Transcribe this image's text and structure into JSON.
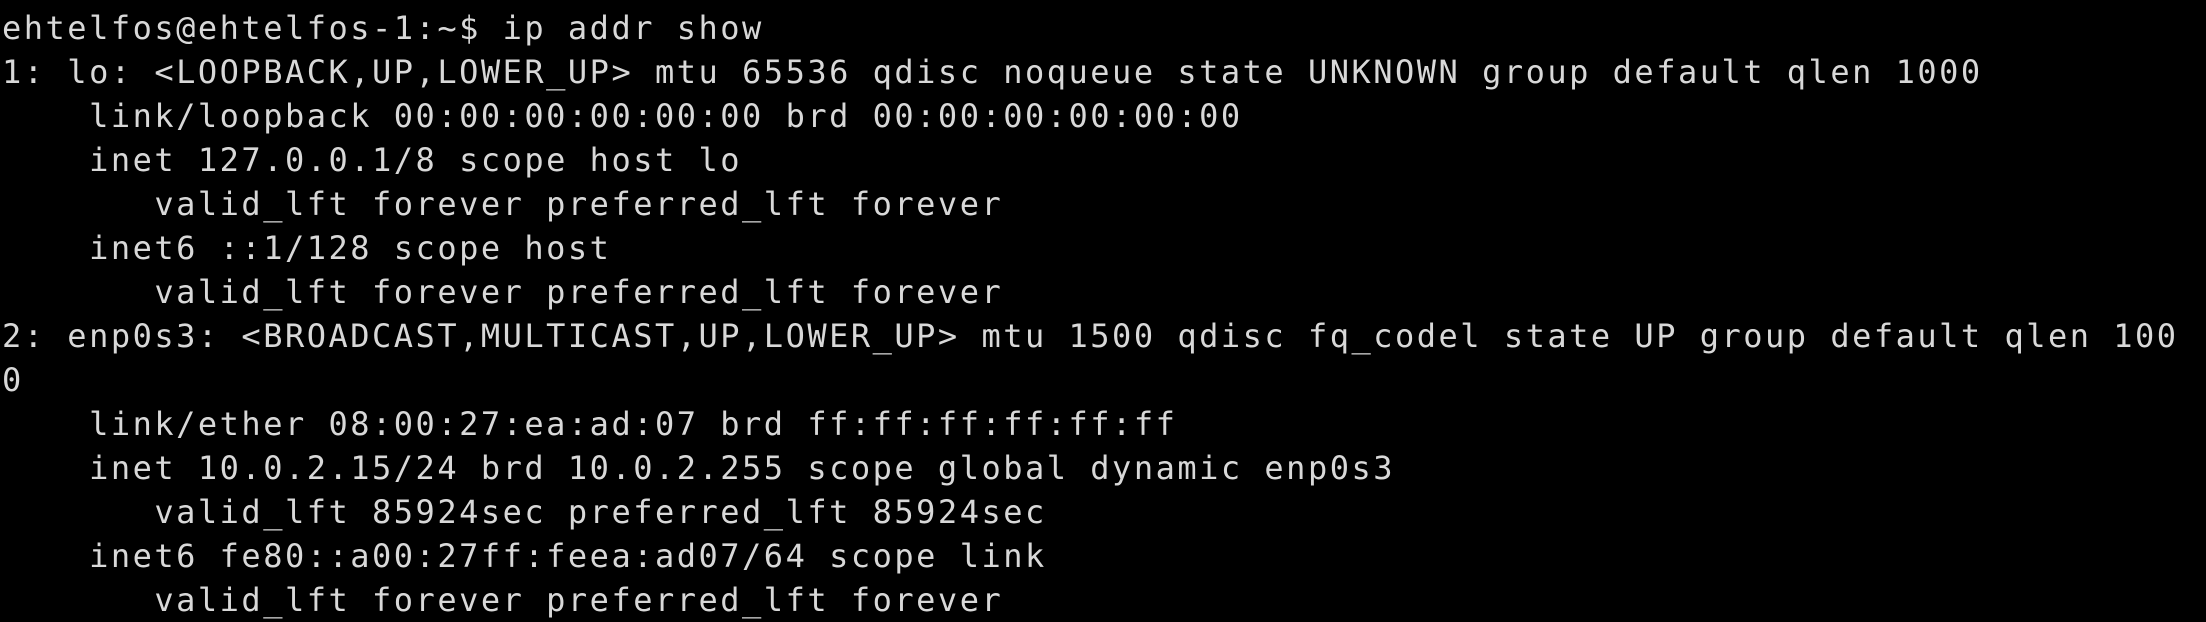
{
  "terminal": {
    "prompt": "ehtelfos@ehtelfos-1:~$",
    "command": "ip addr show",
    "colors": {
      "background": "#000000",
      "foreground": "#d8d8d8"
    },
    "lines": [
      "1: lo: <LOOPBACK,UP,LOWER_UP> mtu 65536 qdisc noqueue state UNKNOWN group default qlen 1000",
      "    link/loopback 00:00:00:00:00:00 brd 00:00:00:00:00:00",
      "    inet 127.0.0.1/8 scope host lo",
      "       valid_lft forever preferred_lft forever",
      "    inet6 ::1/128 scope host",
      "       valid_lft forever preferred_lft forever",
      "2: enp0s3: <BROADCAST,MULTICAST,UP,LOWER_UP> mtu 1500 qdisc fq_codel state UP group default qlen 100",
      "0",
      "    link/ether 08:00:27:ea:ad:07 brd ff:ff:ff:ff:ff:ff",
      "    inet 10.0.2.15/24 brd 10.0.2.255 scope global dynamic enp0s3",
      "       valid_lft 85924sec preferred_lft 85924sec",
      "    inet6 fe80::a00:27ff:feea:ad07/64 scope link",
      "       valid_lft forever preferred_lft forever"
    ]
  }
}
